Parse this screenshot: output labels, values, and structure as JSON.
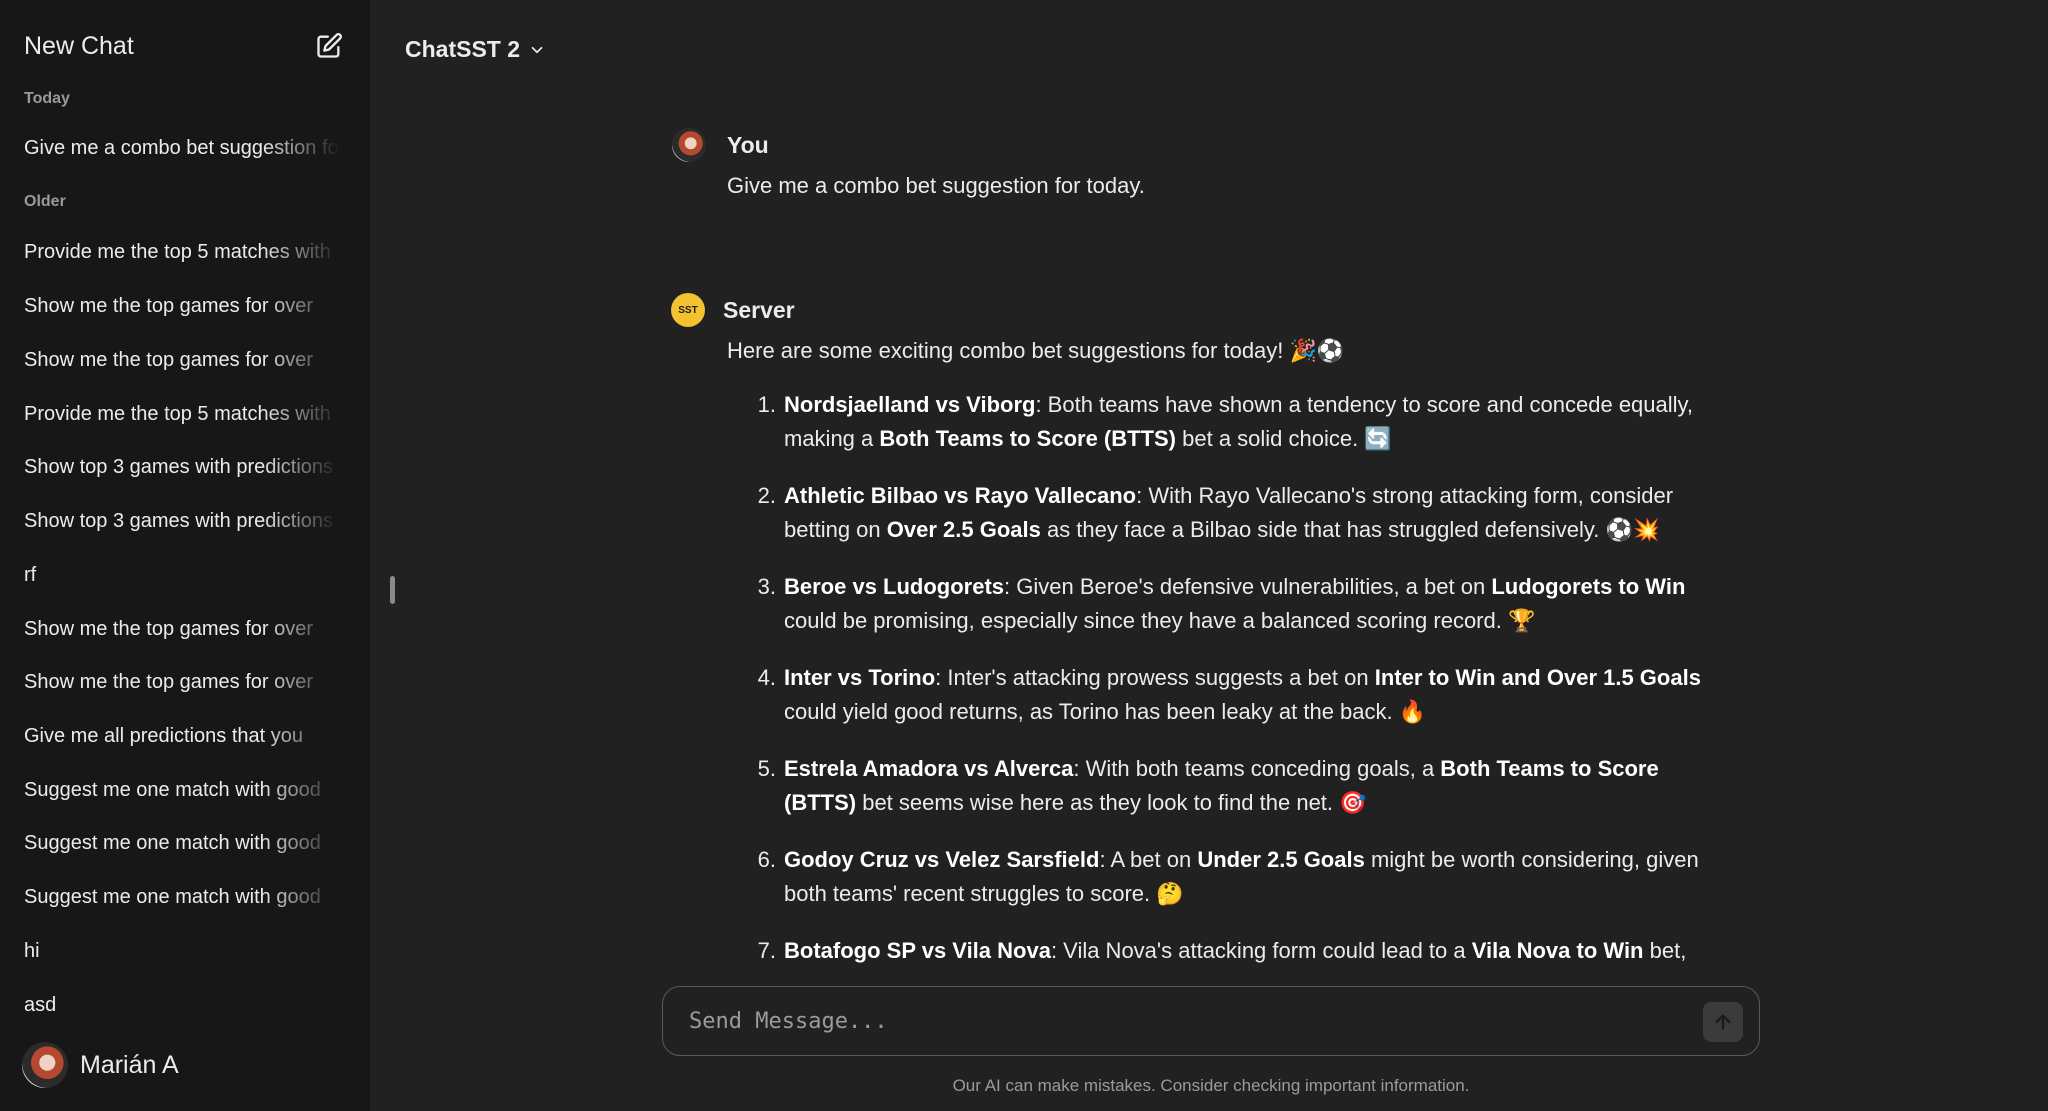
{
  "sidebar": {
    "title": "New Chat",
    "today_label": "Today",
    "today_items": [
      "Give me a combo bet suggestion for today."
    ],
    "older_label": "Older",
    "older_items": [
      "Provide me the top 5 matches with",
      "Show me the top games for over",
      "Show me the top games for over",
      "Provide me the top 5 matches with",
      "Show top 3 games with predictions",
      "Show top 3 games with predictions",
      "rf",
      "Show me the top games for over",
      "Show me the top games for over",
      "Give me all predictions that you",
      "Suggest me one match with good",
      "Suggest me one match with good",
      "Suggest me one match with good",
      "hi",
      "asd"
    ],
    "user_name": "Marián A"
  },
  "header": {
    "model_name": "ChatSST 2"
  },
  "messages": {
    "user_name": "You",
    "user_text": "Give me a combo bet suggestion for today.",
    "server_name": "Server",
    "server_avatar_text": "SST",
    "server_intro": "Here are some exciting combo bet suggestions for today! 🎉⚽",
    "items": [
      {
        "n": "1.",
        "t1": "Nordsjaelland vs Viborg",
        "a": ": Both teams have shown a tendency to score and concede equally, making a ",
        "t2": "Both Teams to Score (BTTS)",
        "b": " bet a solid choice. 🔄"
      },
      {
        "n": "2.",
        "t1": "Athletic Bilbao vs Rayo Vallecano",
        "a": ": With Rayo Vallecano's strong attacking form, consider betting on ",
        "t2": "Over 2.5 Goals",
        "b": " as they face a Bilbao side that has struggled defensively. ⚽💥"
      },
      {
        "n": "3.",
        "t1": "Beroe vs Ludogorets",
        "a": ": Given Beroe's defensive vulnerabilities, a bet on ",
        "t2": "Ludogorets to Win",
        "b": " could be promising, especially since they have a balanced scoring record. 🏆"
      },
      {
        "n": "4.",
        "t1": "Inter vs Torino",
        "a": ": Inter's attacking prowess suggests a bet on ",
        "t2": "Inter to Win and Over 1.5 Goals",
        "b": " could yield good returns, as Torino has been leaky at the back. 🔥"
      },
      {
        "n": "5.",
        "t1": "Estrela Amadora vs Alverca",
        "a": ": With both teams conceding goals, a ",
        "t2": "Both Teams to Score (BTTS)",
        "b": " bet seems wise here as they look to find the net. 🎯"
      },
      {
        "n": "6.",
        "t1": "Godoy Cruz vs Velez Sarsfield",
        "a": ": A bet on ",
        "t2": "Under 2.5 Goals",
        "b": " might be worth considering, given both teams' recent struggles to score. 🤔"
      },
      {
        "n": "7.",
        "t1": "Botafogo SP vs Vila Nova",
        "a": ": Vila Nova's attacking form could lead to a ",
        "t2": "Vila Nova to Win",
        "b": " bet,"
      }
    ]
  },
  "composer": {
    "placeholder": "Send Message...",
    "disclaimer": "Our AI can make mistakes. Consider checking important information."
  }
}
